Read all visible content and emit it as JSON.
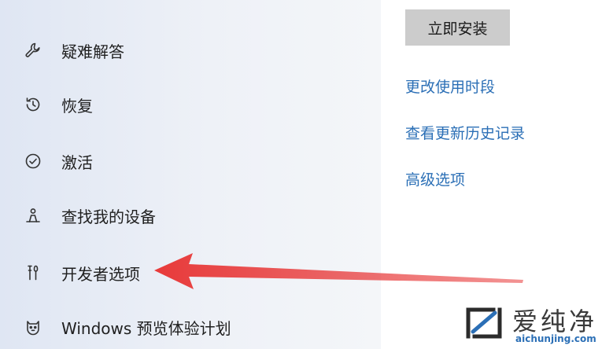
{
  "sidebar": {
    "items": [
      {
        "label": "疑难解答",
        "icon": "wrench-icon"
      },
      {
        "label": "恢复",
        "icon": "history-icon"
      },
      {
        "label": "激活",
        "icon": "check-circle-icon"
      },
      {
        "label": "查找我的设备",
        "icon": "person-location-icon"
      },
      {
        "label": "开发者选项",
        "icon": "developer-tools-icon"
      },
      {
        "label": "Windows 预览体验计划",
        "icon": "cat-icon"
      }
    ]
  },
  "main": {
    "install_button": "立即安装",
    "links": [
      "更改使用时段",
      "查看更新历史记录",
      "高级选项"
    ]
  },
  "watermark": {
    "brand": "爱纯净",
    "url": "aichunjing.com"
  },
  "colors": {
    "link": "#2b6fb6",
    "arrow": "#e83a3a",
    "button_bg": "#cccccc"
  }
}
